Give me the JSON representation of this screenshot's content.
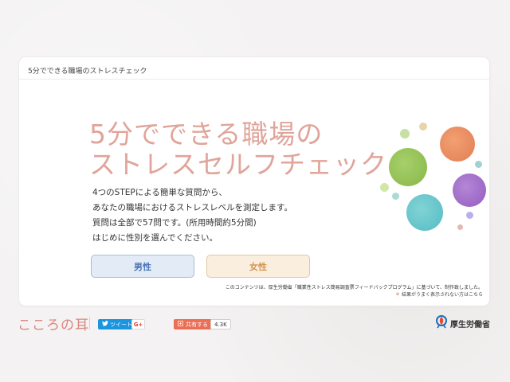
{
  "card": {
    "header": "5分でできる職場のストレスチェック",
    "hero_line1": "5分でできる職場の",
    "hero_line2": "ストレスセルフチェック",
    "desc_lines": [
      "4つのSTEPによる簡単な質問から、",
      "あなたの職場におけるストレスレベルを測定します。",
      "質問は全部で57問です。(所用時間約5分間)",
      "はじめに性別を選んでください。"
    ],
    "buttons": {
      "male": "男性",
      "female": "女性"
    },
    "note_line1": "このコンテンツは、厚生労働省「職業性ストレス簡易調査票フィードバックプログラム」に基づいて、制作致しました。",
    "note_line2": "結果がうまく表示されない方はこちら",
    "note_mark": "＊"
  },
  "footer": {
    "logo": "こころの耳",
    "tweet": "ツイート",
    "gplus": "G+",
    "share": "共有する",
    "share_count": "4.3K",
    "ministry": "厚生労働省"
  },
  "colors": {
    "accent_title": "#e0a49a",
    "male": "#4a74b4",
    "female": "#d29452",
    "twitter": "#1b95e0",
    "share": "#ea6f55"
  },
  "icons": [
    "twitter-bird-icon",
    "share-icon",
    "ministry-emblem-icon"
  ]
}
